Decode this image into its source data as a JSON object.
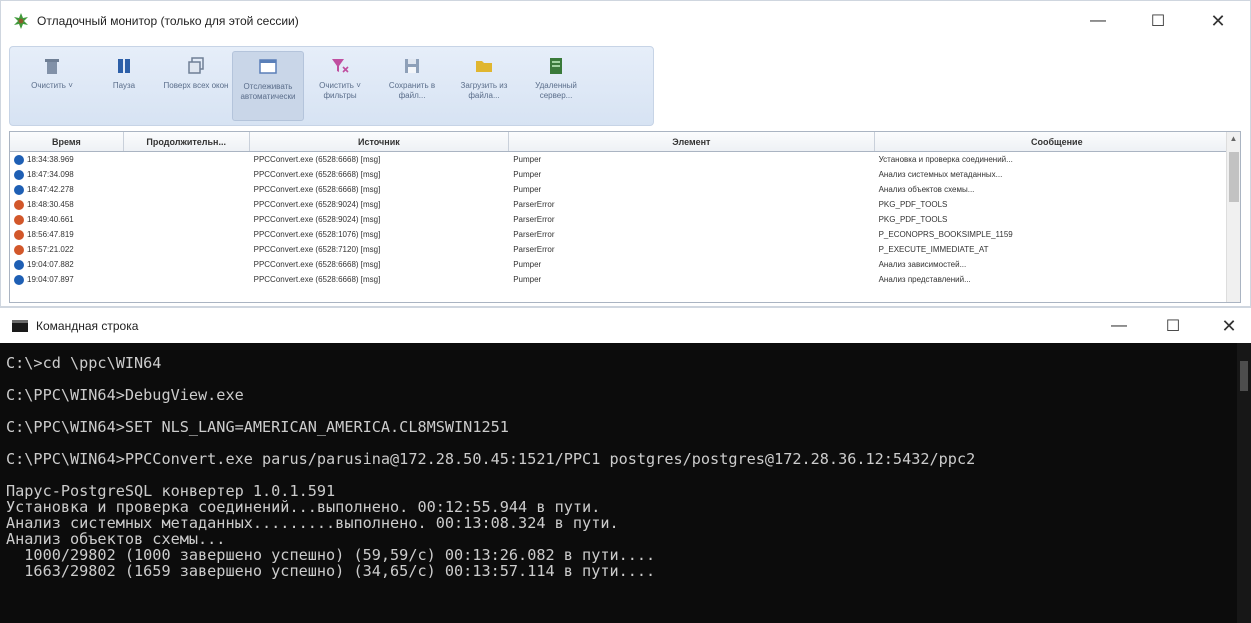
{
  "debug_window": {
    "title": "Отладочный монитор (только для этой сессии)",
    "controls": {
      "minimize": "—",
      "maximize": "☐",
      "close": "✕"
    },
    "ribbon": [
      {
        "label": "Очистить ˅",
        "icon": "trash-icon",
        "color": "#6f7f95",
        "active": false
      },
      {
        "label": "Пауза",
        "icon": "pause-icon",
        "color": "#2c5fa8",
        "active": false
      },
      {
        "label": "Поверх всех окон",
        "icon": "window-stack-icon",
        "color": "#6f7f95",
        "active": false
      },
      {
        "label": "Отслеживать автоматически",
        "icon": "window-icon",
        "color": "#5a7fb8",
        "active": true
      },
      {
        "label": "Очистить ˅ фильтры",
        "icon": "filter-clear-icon",
        "color": "#c04fa0",
        "active": false
      },
      {
        "label": "Сохранить в файл...",
        "icon": "save-icon",
        "color": "#6f7f95",
        "active": false
      },
      {
        "label": "Загрузить из файла...",
        "icon": "folder-icon",
        "color": "#e0b630",
        "active": false
      },
      {
        "label": "Удаленный сервер...",
        "icon": "server-icon",
        "color": "#3a7a3a",
        "active": false
      }
    ],
    "columns": [
      "Время",
      "Продолжительн...",
      "Источник",
      "Элемент",
      "Сообщение"
    ],
    "rows": [
      {
        "level": "info",
        "time": "18:34:38.969",
        "duration": "",
        "source": "PPCConvert.exe (6528:6668) [msg]",
        "element": "Pumper",
        "message": "Установка и проверка соединений..."
      },
      {
        "level": "info",
        "time": "18:47:34.098",
        "duration": "",
        "source": "PPCConvert.exe (6528:6668) [msg]",
        "element": "Pumper",
        "message": "Анализ системных метаданных..."
      },
      {
        "level": "info",
        "time": "18:47:42.278",
        "duration": "",
        "source": "PPCConvert.exe (6528:6668) [msg]",
        "element": "Pumper",
        "message": "Анализ объектов схемы..."
      },
      {
        "level": "err",
        "time": "18:48:30.458",
        "duration": "",
        "source": "PPCConvert.exe (6528:9024) [msg]",
        "element": "ParserError",
        "message": "PKG_PDF_TOOLS"
      },
      {
        "level": "err",
        "time": "18:49:40.661",
        "duration": "",
        "source": "PPCConvert.exe (6528:9024) [msg]",
        "element": "ParserError",
        "message": "PKG_PDF_TOOLS"
      },
      {
        "level": "err",
        "time": "18:56:47.819",
        "duration": "",
        "source": "PPCConvert.exe (6528:1076) [msg]",
        "element": "ParserError",
        "message": "P_ECONOPRS_BOOKSIMPLE_1159"
      },
      {
        "level": "err",
        "time": "18:57:21.022",
        "duration": "",
        "source": "PPCConvert.exe (6528:7120) [msg]",
        "element": "ParserError",
        "message": "P_EXECUTE_IMMEDIATE_AT"
      },
      {
        "level": "info",
        "time": "19:04:07.882",
        "duration": "",
        "source": "PPCConvert.exe (6528:6668) [msg]",
        "element": "Pumper",
        "message": "Анализ зависимостей..."
      },
      {
        "level": "info",
        "time": "19:04:07.897",
        "duration": "",
        "source": "PPCConvert.exe (6528:6668) [msg]",
        "element": "Pumper",
        "message": "Анализ представлений..."
      }
    ]
  },
  "cmd_window": {
    "title": "Командная строка",
    "controls": {
      "minimize": "—",
      "maximize": "☐",
      "close": "✕"
    },
    "lines": [
      "C:\\>cd \\ppc\\WIN64",
      "",
      "C:\\PPC\\WIN64>DebugView.exe",
      "",
      "C:\\PPC\\WIN64>SET NLS_LANG=AMERICAN_AMERICA.CL8MSWIN1251",
      "",
      "C:\\PPC\\WIN64>PPCConvert.exe parus/parusina@172.28.50.45:1521/PPC1 postgres/postgres@172.28.36.12:5432/ppc2",
      "",
      "Парус-PostgreSQL конвертер 1.0.1.591",
      "Установка и проверка соединений...выполнено. 00:12:55.944 в пути.",
      "Анализ системных метаданных.........выполнено. 00:13:08.324 в пути.",
      "Анализ объектов схемы...",
      "  1000/29802 (1000 завершено успешно) (59,59/с) 00:13:26.082 в пути....",
      "  1663/29802 (1659 завершено успешно) (34,65/с) 00:13:57.114 в пути...."
    ]
  }
}
